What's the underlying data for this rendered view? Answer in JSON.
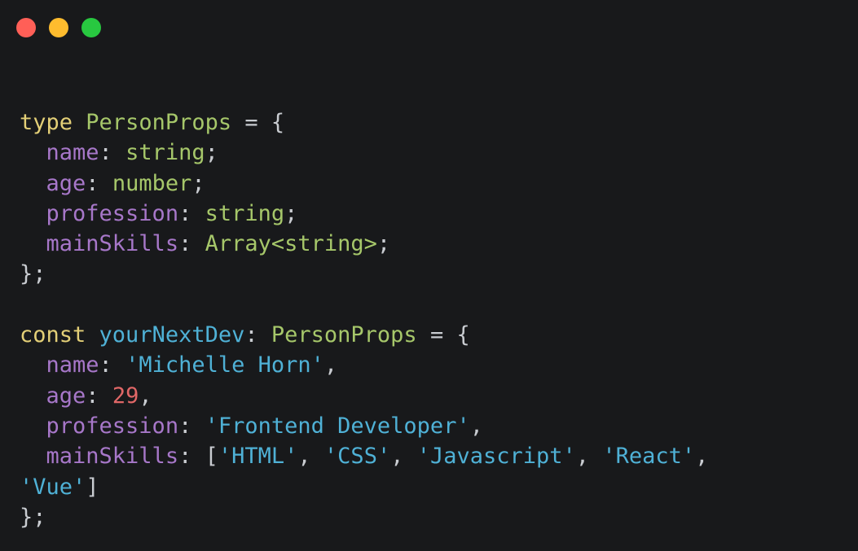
{
  "window": {
    "controls": {
      "close_color": "#ff5f57",
      "minimize_color": "#febc2e",
      "maximize_color": "#28c840"
    }
  },
  "code": {
    "kw_type": "type",
    "type_name": "PersonProps",
    "kw_const": "const",
    "var_name": "yourNextDev",
    "name_key": "name",
    "age_key": "age",
    "profession_key": "profession",
    "skills_key": "mainSkills",
    "t_string": "string",
    "t_number": "number",
    "t_array": "Array<string>",
    "v_name": "'Michelle Horn'",
    "v_age": "29",
    "v_profession": "'Frontend Developer'",
    "v_skills": [
      "'HTML'",
      "'CSS'",
      "'Javascript'",
      "'React'",
      "'Vue'"
    ]
  },
  "colors": {
    "background": "#18191b",
    "keyword": "#e3cf77",
    "type": "#a6c76a",
    "property": "#a777c9",
    "string": "#4fb1d6",
    "number": "#e06767",
    "punctuation": "#c9ccd1"
  }
}
